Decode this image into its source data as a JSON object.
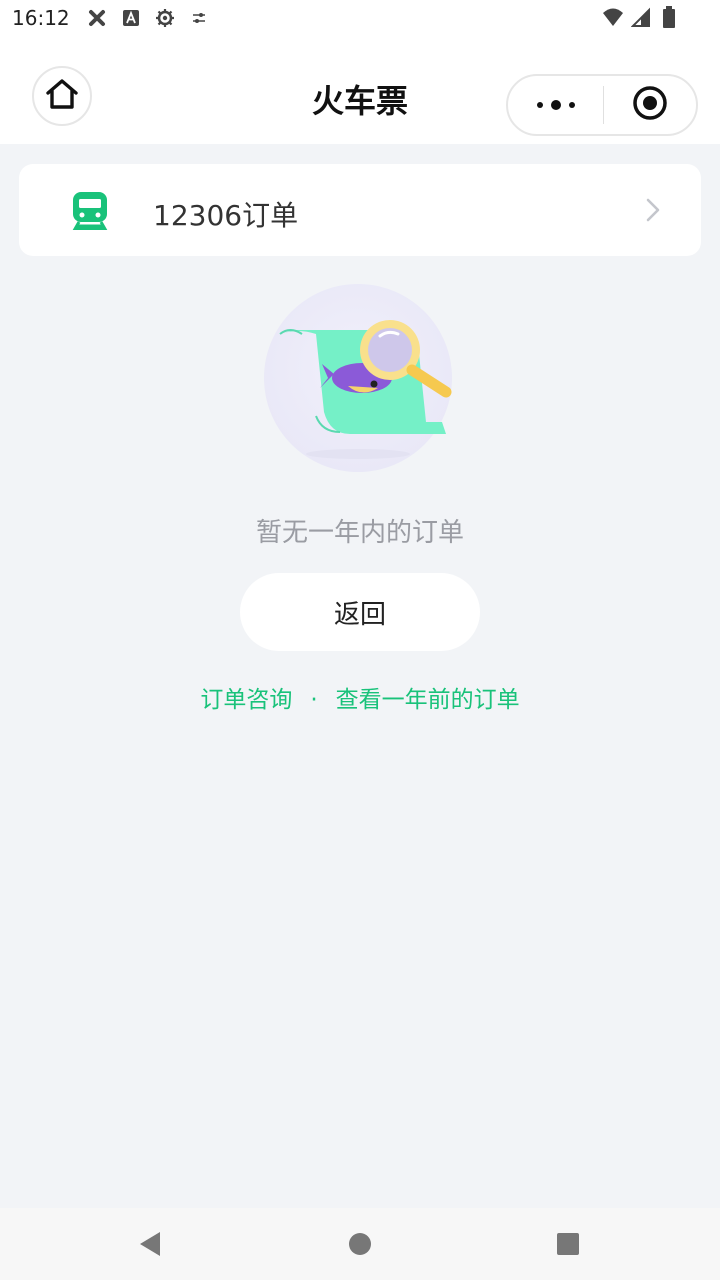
{
  "status_bar": {
    "time": "16:12",
    "left_icons": [
      "ribbon-icon",
      "a-letter-icon",
      "settings-gear-icon",
      "sliders-icon"
    ],
    "right_icons": [
      "wifi-icon",
      "signal-icon",
      "battery-icon"
    ]
  },
  "nav": {
    "title": "火车票",
    "home_icon": "home-icon",
    "more_icon": "more-dots-icon",
    "close_icon": "target-close-icon"
  },
  "order_card": {
    "label": "12306订单",
    "icon": "train-icon",
    "accent": "#19c27a"
  },
  "empty_state": {
    "illustration": "magnifier-over-paper-illustration",
    "message": "暂无一年内的订单",
    "back_button": "返回"
  },
  "links": {
    "consult": "订单咨询",
    "separator": "·",
    "older_orders": "查看一年前的订单",
    "color": "#19c27a"
  },
  "system_nav": [
    "back-triangle-icon",
    "home-circle-icon",
    "recents-square-icon"
  ]
}
